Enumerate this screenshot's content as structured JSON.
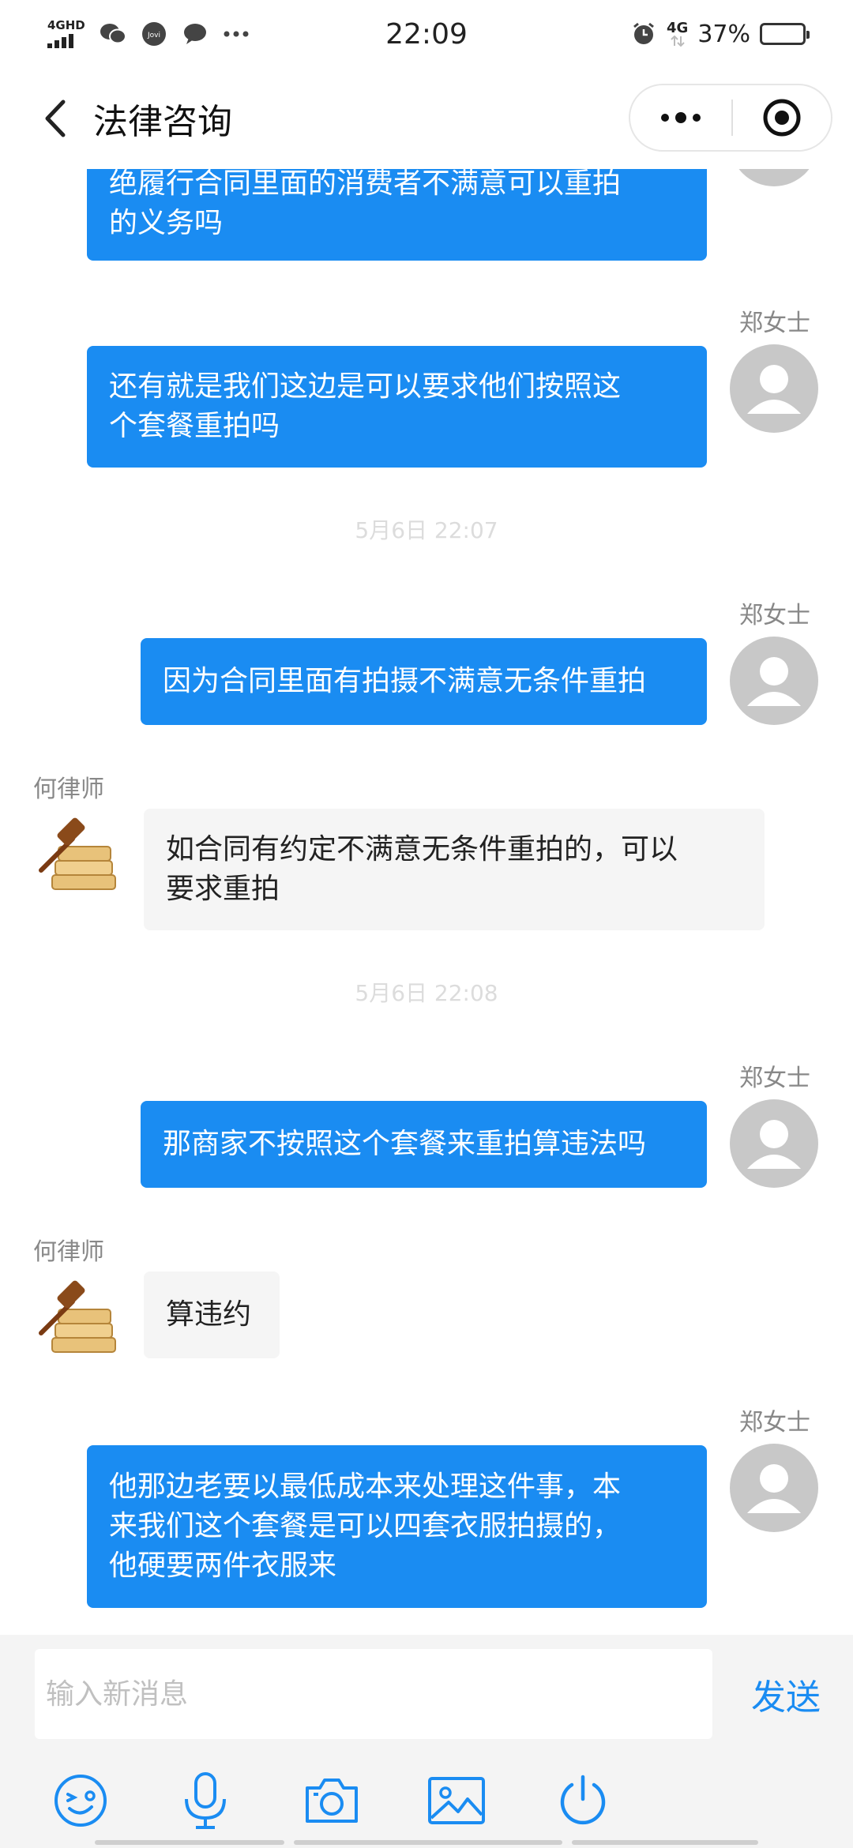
{
  "status_bar": {
    "network_label": "4GHD",
    "time": "22:09",
    "signal_label": "4G",
    "battery": "37%",
    "battery_level": 0.37
  },
  "nav": {
    "title": "法律咨询"
  },
  "messages": {
    "m1": {
      "line1": "绝履行合同里面的消费者不满意可以重拍",
      "line2": "的义务吗"
    },
    "m2": {
      "sender": "郑女士",
      "line1": "还有就是我们这边是可以要求他们按照这",
      "line2": "个套餐重拍吗"
    },
    "ts1": "5月6日 22:07",
    "m3": {
      "sender": "郑女士",
      "line1": "因为合同里面有拍摄不满意无条件重拍"
    },
    "m4": {
      "sender": "何律师",
      "line1": "如合同有约定不满意无条件重拍的，可以",
      "line2": "要求重拍"
    },
    "ts2": "5月6日 22:08",
    "m5": {
      "sender": "郑女士",
      "line1": "那商家不按照这个套餐来重拍算违法吗"
    },
    "m6": {
      "sender": "何律师",
      "line1": "算违约"
    },
    "m7": {
      "sender": "郑女士",
      "line1": "他那边老要以最低成本来处理这件事，本",
      "line2": "来我们这个套餐是可以四套衣服拍摄的，",
      "line3": "他硬要两件衣服来"
    }
  },
  "input": {
    "placeholder": "输入新消息",
    "send_label": "发送"
  },
  "colors": {
    "accent": "#1a8cf2",
    "incoming_bubble": "#f5f5f5",
    "toolbar_bg": "#f4f4f4"
  },
  "icons": [
    "emoji-icon",
    "microphone-icon",
    "camera-icon",
    "image-icon",
    "power-icon"
  ]
}
